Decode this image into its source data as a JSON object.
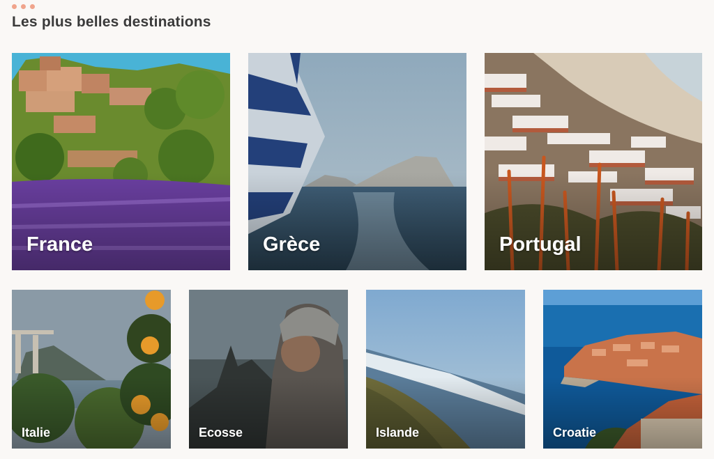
{
  "section": {
    "title": "Les plus belles destinations"
  },
  "destinations_large": [
    {
      "name": "France"
    },
    {
      "name": "Grèce"
    },
    {
      "name": "Portugal"
    }
  ],
  "destinations_small": [
    {
      "name": "Italie"
    },
    {
      "name": "Ecosse"
    },
    {
      "name": "Islande"
    },
    {
      "name": "Croatie"
    }
  ],
  "colors": {
    "accent_dots": "#f0a48c",
    "title": "#3a3a3a",
    "background": "#faf8f6"
  }
}
